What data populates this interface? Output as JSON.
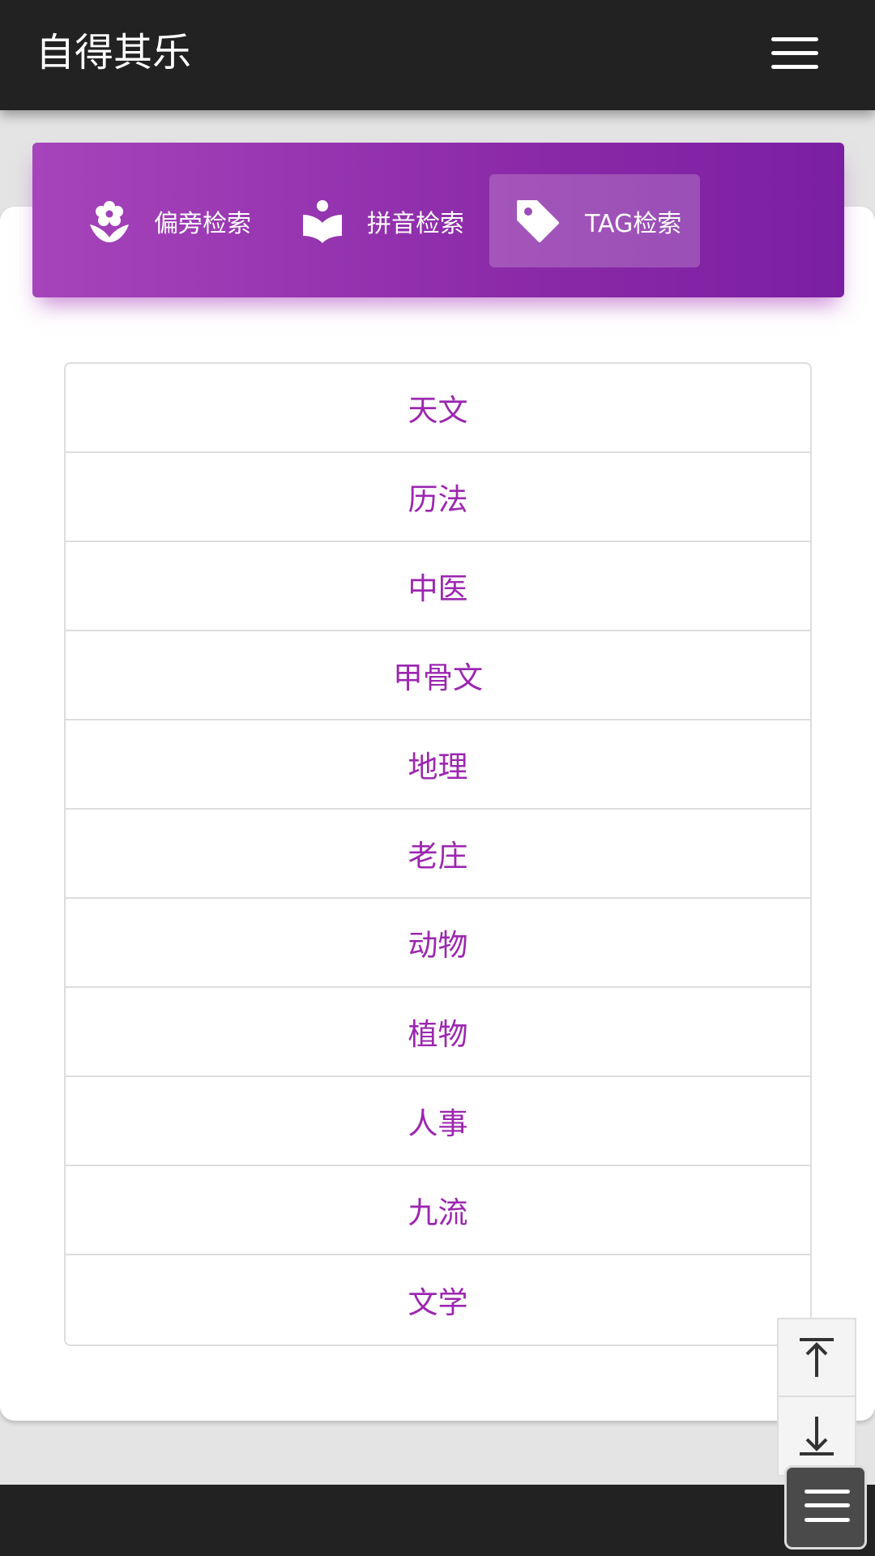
{
  "header": {
    "title": "自得其乐",
    "menu_icon": "hamburger-menu-icon"
  },
  "tabs": [
    {
      "label": "偏旁检索",
      "icon": "flower-icon",
      "active": false
    },
    {
      "label": "拼音检索",
      "icon": "reader-icon",
      "active": false
    },
    {
      "label": "TAG检索",
      "icon": "tag-icon",
      "active": true
    }
  ],
  "tags": [
    "天文",
    "历法",
    "中医",
    "甲骨文",
    "地理",
    "老庄",
    "动物",
    "植物",
    "人事",
    "九流",
    "文学"
  ],
  "scroll": {
    "top_icon": "arrow-to-top-icon",
    "bottom_icon": "arrow-to-bottom-icon"
  },
  "colors": {
    "accent": "#9c27b0",
    "topbar": "#222222"
  }
}
